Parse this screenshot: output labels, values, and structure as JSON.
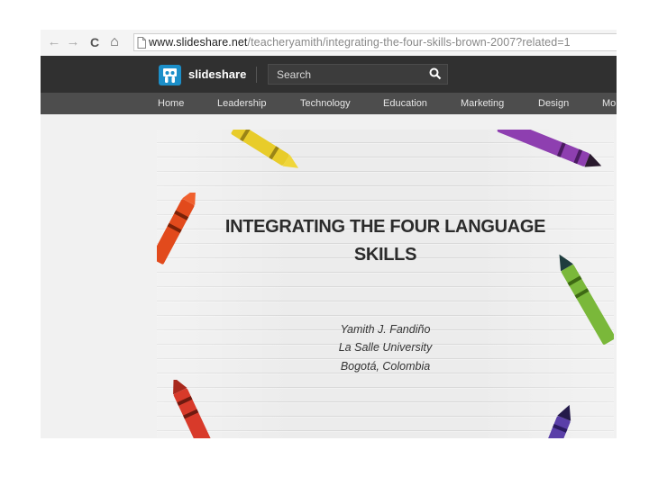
{
  "browser": {
    "back_glyph": "←",
    "forward_glyph": "→",
    "reload_glyph": "C",
    "home_glyph": "⌂",
    "url_domain": "www.slideshare.net",
    "url_path": "/teacheryamith/integrating-the-four-skills-brown-2007?related=1"
  },
  "header": {
    "brand": "slideshare",
    "search_placeholder": "Search"
  },
  "nav": {
    "items": [
      "Home",
      "Leadership",
      "Technology",
      "Education",
      "Marketing",
      "Design",
      "Mo"
    ]
  },
  "slide": {
    "title_line1": "INTEGRATING THE FOUR LANGUAGE",
    "title_line2": "SKILLS",
    "author": "Yamith J. Fandiño",
    "institution": "La Salle University",
    "location": "Bogotá, Colombia"
  },
  "colors": {
    "header_bg": "#303030",
    "nav_bg": "#4d4d4d",
    "brand_blue": "#1c8fc9"
  }
}
